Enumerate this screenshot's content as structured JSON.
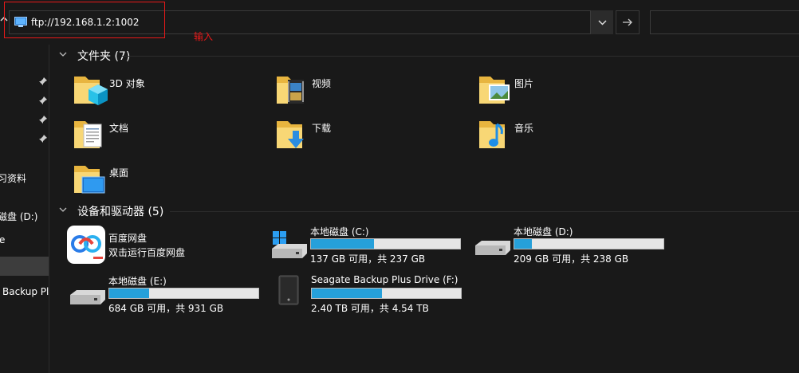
{
  "address_bar": {
    "path": "ftp://192.168.1.2:1002",
    "annotation": "输入"
  },
  "nav_pane": {
    "items": [
      {
        "label": "习资料"
      },
      {
        "label": "磁盘 (D:)"
      },
      {
        "label": "e"
      },
      {
        "label": "Backup Plu"
      }
    ]
  },
  "folders_group": {
    "title": "文件夹 (7)",
    "items": [
      {
        "label": "3D 对象",
        "icon": "folder-3d-objects-icon"
      },
      {
        "label": "视频",
        "icon": "folder-videos-icon"
      },
      {
        "label": "图片",
        "icon": "folder-pictures-icon"
      },
      {
        "label": "文档",
        "icon": "folder-documents-icon"
      },
      {
        "label": "下载",
        "icon": "folder-downloads-icon"
      },
      {
        "label": "音乐",
        "icon": "folder-music-icon"
      },
      {
        "label": "桌面",
        "icon": "folder-desktop-icon"
      }
    ]
  },
  "devices_group": {
    "title": "设备和驱动器 (5)",
    "app": {
      "label": "百度网盘",
      "sub": "双击运行百度网盘",
      "icon": "baidu-netdisk-icon"
    },
    "drives": [
      {
        "label": "本地磁盘 (C:)",
        "free": "137 GB 可用，共 237 GB",
        "used_fraction": 0.42,
        "icon": "windows-drive-icon"
      },
      {
        "label": "本地磁盘 (D:)",
        "free": "209 GB 可用，共 238 GB",
        "used_fraction": 0.12,
        "icon": "hard-drive-icon"
      },
      {
        "label": "本地磁盘 (E:)",
        "free": "684 GB 可用，共 931 GB",
        "used_fraction": 0.27,
        "icon": "hard-drive-icon"
      },
      {
        "label": "Seagate Backup Plus Drive (F:)",
        "free": "2.40 TB 可用，共 4.54 TB",
        "used_fraction": 0.47,
        "icon": "external-drive-icon"
      }
    ]
  },
  "colors": {
    "background": "#191919",
    "bar_fill": "#26a0da",
    "annotation": "#e81919"
  }
}
